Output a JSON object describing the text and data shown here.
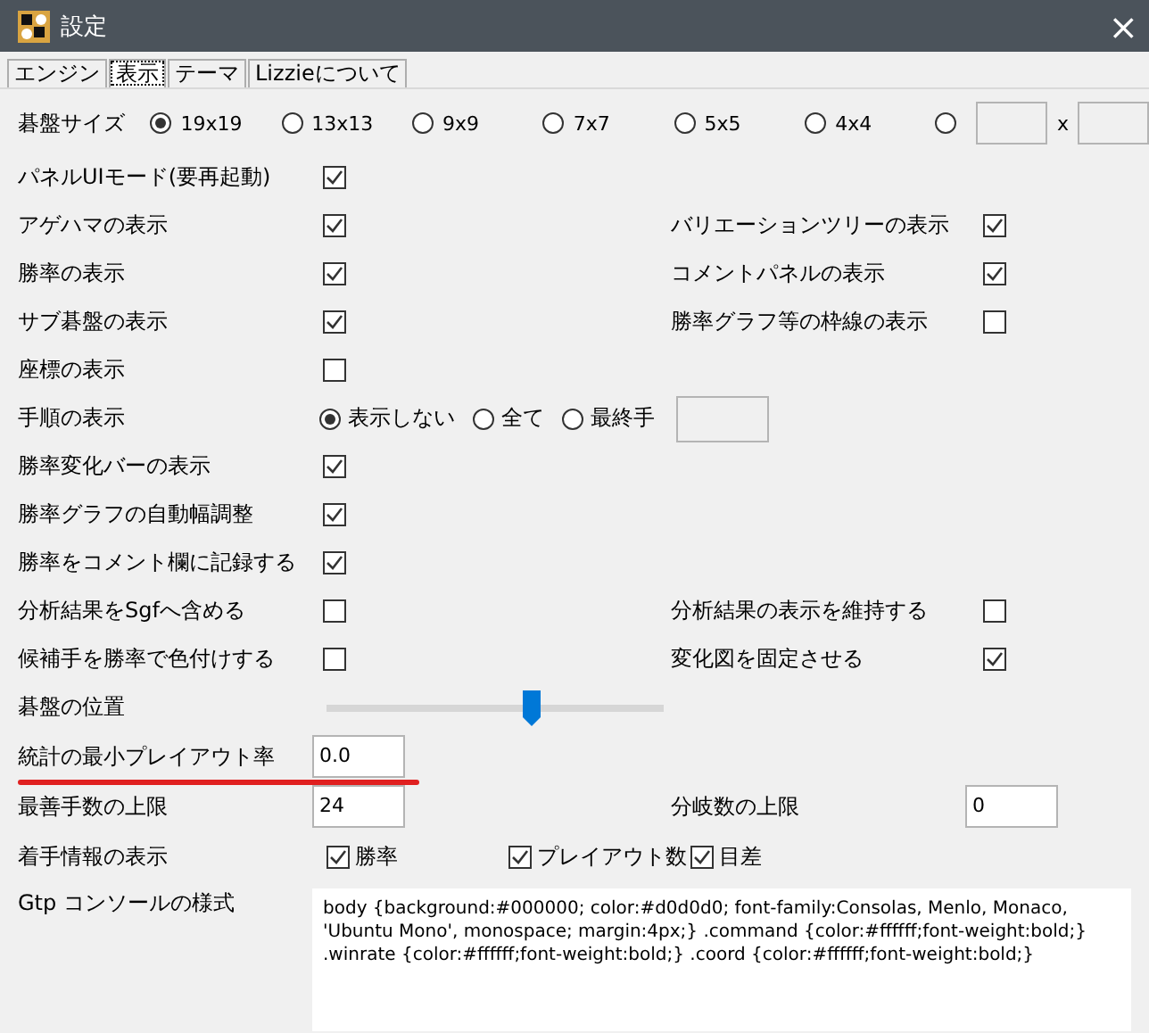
{
  "window": {
    "title": "設定",
    "close": "×"
  },
  "tabs": [
    {
      "label": "エンジン",
      "selected": false
    },
    {
      "label": "表示",
      "selected": true
    },
    {
      "label": "テーマ",
      "selected": false
    },
    {
      "label": "Lizzieについて",
      "selected": false
    }
  ],
  "board_size": {
    "label": "碁盤サイズ",
    "options": [
      {
        "label": "19x19",
        "selected": true
      },
      {
        "label": "13x13",
        "selected": false
      },
      {
        "label": "9x9",
        "selected": false
      },
      {
        "label": "7x7",
        "selected": false
      },
      {
        "label": "5x5",
        "selected": false
      },
      {
        "label": "4x4",
        "selected": false
      }
    ],
    "custom": {
      "selected": false,
      "separator": "x"
    }
  },
  "rows": [
    {
      "items": [
        {
          "kind": "checkbox",
          "label": "パネルUIモード(要再起動)",
          "checked": true
        }
      ]
    },
    {
      "items": [
        {
          "kind": "checkbox",
          "label": "アゲハマの表示",
          "checked": true
        },
        {
          "kind": "checkbox",
          "label": "バリエーションツリーの表示",
          "checked": true
        }
      ]
    },
    {
      "items": [
        {
          "kind": "checkbox",
          "label": "勝率の表示",
          "checked": true
        },
        {
          "kind": "checkbox",
          "label": "コメントパネルの表示",
          "checked": true
        }
      ]
    },
    {
      "items": [
        {
          "kind": "checkbox",
          "label": "サブ碁盤の表示",
          "checked": true
        },
        {
          "kind": "checkbox",
          "label": "勝率グラフ等の枠線の表示",
          "checked": false
        }
      ]
    },
    {
      "items": [
        {
          "kind": "checkbox",
          "label": "座標の表示",
          "checked": false
        }
      ]
    },
    {
      "items": [
        {
          "kind": "radios",
          "label": "手順の表示",
          "trailing_field": true,
          "options": [
            {
              "label": "表示しない",
              "selected": true
            },
            {
              "label": "全て",
              "selected": false
            },
            {
              "label": "最終手",
              "selected": false
            }
          ]
        }
      ]
    },
    {
      "items": [
        {
          "kind": "checkbox",
          "label": "勝率変化バーの表示",
          "checked": true
        }
      ]
    },
    {
      "items": [
        {
          "kind": "checkbox",
          "label": "勝率グラフの自動幅調整",
          "checked": true
        }
      ]
    },
    {
      "items": [
        {
          "kind": "checkbox",
          "label": "勝率をコメント欄に記録する",
          "checked": true
        }
      ]
    },
    {
      "items": [
        {
          "kind": "checkbox",
          "label": "分析結果をSgfへ含める",
          "checked": false
        },
        {
          "kind": "checkbox",
          "label": "分析結果の表示を維持する",
          "checked": false
        }
      ]
    },
    {
      "items": [
        {
          "kind": "checkbox",
          "label": "候補手を勝率で色付けする",
          "checked": false
        },
        {
          "kind": "checkbox",
          "label": "変化図を固定させる",
          "checked": true
        }
      ]
    },
    {
      "items": [
        {
          "kind": "slider",
          "label": "碁盤の位置",
          "level": 0.61
        }
      ]
    },
    {
      "underline": true,
      "items": [
        {
          "kind": "text",
          "label": "統計の最小プレイアウト率",
          "value": "0.0"
        }
      ]
    },
    {
      "items": [
        {
          "kind": "text",
          "label": "最善手数の上限",
          "value": "24"
        },
        {
          "kind": "text",
          "label": "分岐数の上限",
          "value": "0"
        }
      ]
    },
    {
      "items": [
        {
          "kind": "checks",
          "label": "着手情報の表示",
          "options": [
            {
              "label": "勝率",
              "checked": true
            },
            {
              "label": "プレイアウト数",
              "checked": true
            },
            {
              "label": "目差",
              "checked": true
            }
          ]
        }
      ]
    },
    {
      "items": [
        {
          "kind": "textarea",
          "label": "Gtp コンソールの様式",
          "value": "body {background:#000000; color:#d0d0d0; font-family:Consolas, Menlo, Monaco, 'Ubuntu Mono', monospace; margin:4px;} .command {color:#ffffff;font-weight:bold;} .winrate {color:#ffffff;font-weight:bold;} .coord {color:#ffffff;font-weight:bold;}"
        }
      ]
    }
  ]
}
